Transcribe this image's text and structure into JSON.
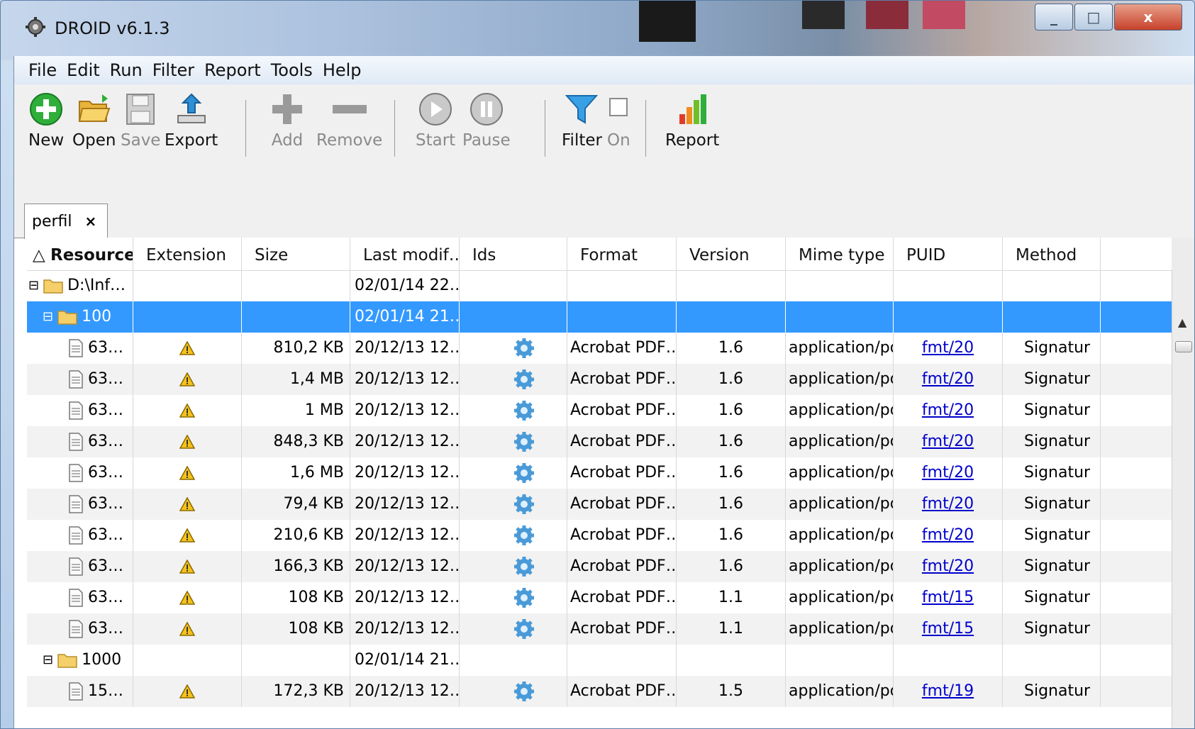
{
  "window": {
    "title": "DROID v6.1.3",
    "minimize_label": "_",
    "maximize_label": "□",
    "close_label": "x"
  },
  "menu": [
    "File",
    "Edit",
    "Run",
    "Filter",
    "Report",
    "Tools",
    "Help"
  ],
  "toolbar": {
    "new": "New",
    "open": "Open",
    "save": "Save",
    "export": "Export",
    "add": "Add",
    "remove": "Remove",
    "start": "Start",
    "pause": "Pause",
    "filter": "Filter",
    "filter_on": "On",
    "report": "Report"
  },
  "tab": {
    "label": "perfil",
    "close": "×"
  },
  "columns": [
    "Resource",
    "Extension",
    "Size",
    "Last modif…",
    "Ids",
    "Format",
    "Version",
    "Mime type",
    "PUID",
    "Method"
  ],
  "sort_indicator": "△",
  "rows": [
    {
      "kind": "folder",
      "level": 0,
      "name": "D:\\Inf…",
      "expander": "−",
      "modified": "02/01/14 22…"
    },
    {
      "kind": "folder",
      "level": 1,
      "name": "100",
      "expander": "−",
      "modified": "02/01/14 21…",
      "selected": true
    },
    {
      "kind": "file",
      "name": "63…",
      "size": "810,2 KB",
      "modified": "20/12/13 12…",
      "format": "Acrobat PDF…",
      "version": "1.6",
      "mime": "application/pdf",
      "puid": "fmt/20",
      "method": "Signatur"
    },
    {
      "kind": "file",
      "name": "63…",
      "size": "1,4 MB",
      "modified": "20/12/13 12…",
      "format": "Acrobat PDF…",
      "version": "1.6",
      "mime": "application/pdf",
      "puid": "fmt/20",
      "method": "Signatur"
    },
    {
      "kind": "file",
      "name": "63…",
      "size": "1 MB",
      "modified": "20/12/13 12…",
      "format": "Acrobat PDF…",
      "version": "1.6",
      "mime": "application/pdf",
      "puid": "fmt/20",
      "method": "Signatur"
    },
    {
      "kind": "file",
      "name": "63…",
      "size": "848,3 KB",
      "modified": "20/12/13 12…",
      "format": "Acrobat PDF…",
      "version": "1.6",
      "mime": "application/pdf",
      "puid": "fmt/20",
      "method": "Signatur"
    },
    {
      "kind": "file",
      "name": "63…",
      "size": "1,6 MB",
      "modified": "20/12/13 12…",
      "format": "Acrobat PDF…",
      "version": "1.6",
      "mime": "application/pdf",
      "puid": "fmt/20",
      "method": "Signatur"
    },
    {
      "kind": "file",
      "name": "63…",
      "size": "79,4 KB",
      "modified": "20/12/13 12…",
      "format": "Acrobat PDF…",
      "version": "1.6",
      "mime": "application/pdf",
      "puid": "fmt/20",
      "method": "Signatur"
    },
    {
      "kind": "file",
      "name": "63…",
      "size": "210,6 KB",
      "modified": "20/12/13 12…",
      "format": "Acrobat PDF…",
      "version": "1.6",
      "mime": "application/pdf",
      "puid": "fmt/20",
      "method": "Signatur"
    },
    {
      "kind": "file",
      "name": "63…",
      "size": "166,3 KB",
      "modified": "20/12/13 12…",
      "format": "Acrobat PDF…",
      "version": "1.6",
      "mime": "application/pdf",
      "puid": "fmt/20",
      "method": "Signatur"
    },
    {
      "kind": "file",
      "name": "63…",
      "size": "108 KB",
      "modified": "20/12/13 12…",
      "format": "Acrobat PDF…",
      "version": "1.1",
      "mime": "application/pdf",
      "puid": "fmt/15",
      "method": "Signatur"
    },
    {
      "kind": "file",
      "name": "63…",
      "size": "108 KB",
      "modified": "20/12/13 12…",
      "format": "Acrobat PDF…",
      "version": "1.1",
      "mime": "application/pdf",
      "puid": "fmt/15",
      "method": "Signatur"
    },
    {
      "kind": "folder",
      "level": 1,
      "name": "1000",
      "expander": "−",
      "modified": "02/01/14 21…"
    },
    {
      "kind": "file",
      "name": "15…",
      "size": "172,3 KB",
      "modified": "20/12/13 12…",
      "format": "Acrobat PDF…",
      "version": "1.5",
      "mime": "application/pdf",
      "puid": "fmt/19",
      "method": "Signatur"
    }
  ],
  "icons": {
    "extension_warning": "warning-icon",
    "ids": "gear-icon",
    "file": "document-icon",
    "folder": "folder-icon"
  }
}
